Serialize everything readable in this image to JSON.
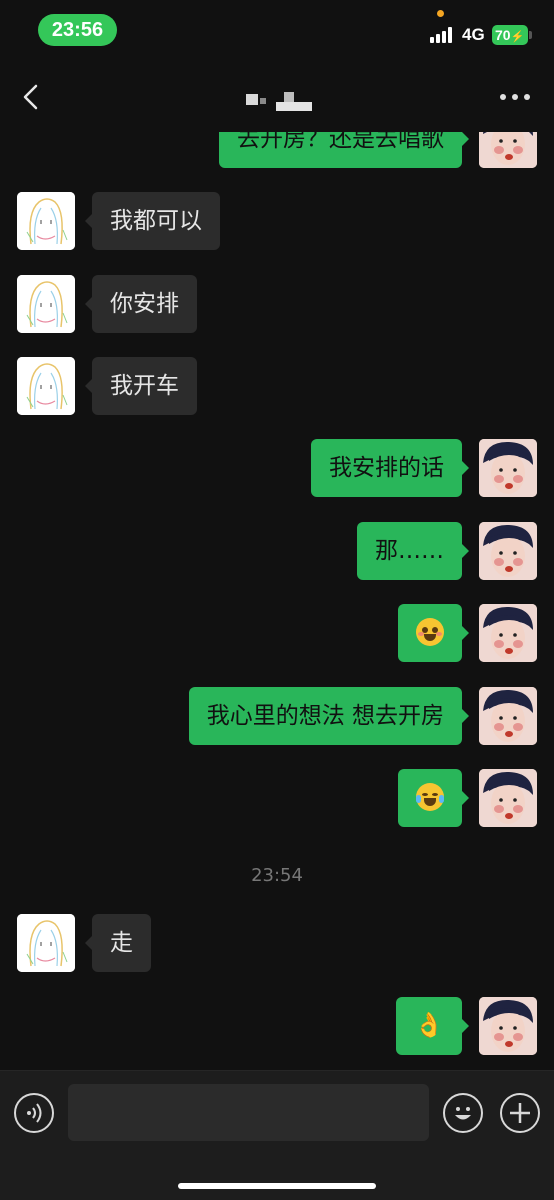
{
  "status_bar": {
    "time": "23:56",
    "network": "4G",
    "battery": "70"
  },
  "header": {
    "back_icon": "chevron-left-icon",
    "more_icon": "more-dots-icon"
  },
  "messages": [
    {
      "side": "right",
      "text": "去开房？还是去唱歌"
    },
    {
      "side": "left",
      "text": "我都可以"
    },
    {
      "side": "left",
      "text": "你安排"
    },
    {
      "side": "left",
      "text": "我开车"
    },
    {
      "side": "right",
      "text": "我安排的话"
    },
    {
      "side": "right",
      "text": "那……"
    },
    {
      "side": "right",
      "emoji": "blushing-grin-emoji"
    },
    {
      "side": "right",
      "text": "我心里的想法 想去开房"
    },
    {
      "side": "right",
      "emoji": "tears-of-joy-emoji"
    },
    {
      "side": "left",
      "text": "走"
    },
    {
      "side": "right",
      "emoji": "ok-hand-emoji"
    }
  ],
  "timestamp": "23:54",
  "input_bar": {
    "voice_icon": "voice-icon",
    "emoji_icon": "smiley-icon",
    "plus_icon": "plus-icon",
    "placeholder": ""
  },
  "colors": {
    "bubble_sent": "#29b65a",
    "bubble_received": "#2c2c2c",
    "background": "#111111",
    "status_green": "#34c759"
  }
}
